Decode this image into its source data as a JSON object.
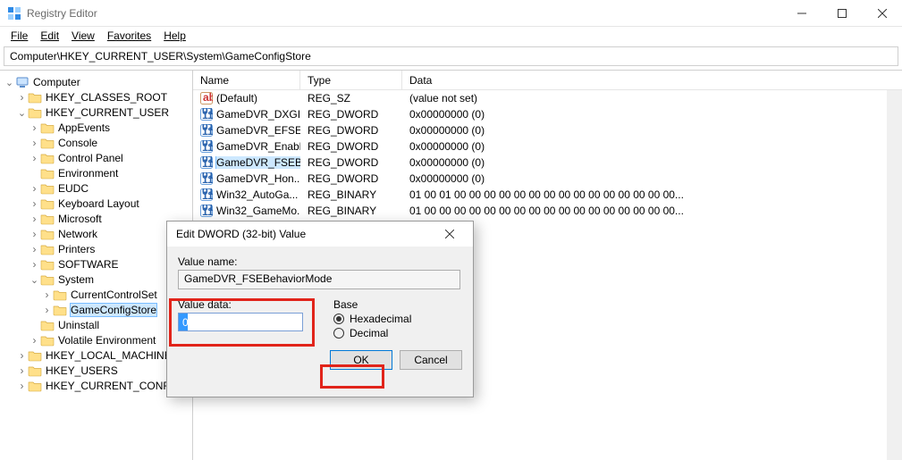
{
  "window": {
    "title": "Registry Editor"
  },
  "menus": {
    "file": "File",
    "edit": "Edit",
    "view": "View",
    "favorites": "Favorites",
    "help": "Help"
  },
  "address": "Computer\\HKEY_CURRENT_USER\\System\\GameConfigStore",
  "tree": {
    "root": "Computer",
    "hkcr": "HKEY_CLASSES_ROOT",
    "hkcu": "HKEY_CURRENT_USER",
    "hkcu_children": {
      "appevents": "AppEvents",
      "console": "Console",
      "controlpanel": "Control Panel",
      "environment": "Environment",
      "eudc": "EUDC",
      "kbd": "Keyboard Layout",
      "microsoft": "Microsoft",
      "network": "Network",
      "printers": "Printers",
      "software": "SOFTWARE",
      "system": "System",
      "ccs": "CurrentControlSet",
      "gamecfg": "GameConfigStore",
      "uninstall": "Uninstall",
      "volatileenv": "Volatile Environment"
    },
    "hklm": "HKEY_LOCAL_MACHINE",
    "hku": "HKEY_USERS",
    "hkcc": "HKEY_CURRENT_CONFIG"
  },
  "cols": {
    "name": "Name",
    "type": "Type",
    "data": "Data"
  },
  "rows": [
    {
      "name": "(Default)",
      "type": "REG_SZ",
      "data": "(value not set)",
      "icon": "str"
    },
    {
      "name": "GameDVR_DXGI...",
      "type": "REG_DWORD",
      "data": "0x00000000 (0)",
      "icon": "num"
    },
    {
      "name": "GameDVR_EFSE...",
      "type": "REG_DWORD",
      "data": "0x00000000 (0)",
      "icon": "num"
    },
    {
      "name": "GameDVR_Enabl...",
      "type": "REG_DWORD",
      "data": "0x00000000 (0)",
      "icon": "num"
    },
    {
      "name": "GameDVR_FSEB...",
      "type": "REG_DWORD",
      "data": "0x00000000 (0)",
      "icon": "num",
      "selected": true
    },
    {
      "name": "GameDVR_Hon...",
      "type": "REG_DWORD",
      "data": "0x00000000 (0)",
      "icon": "num"
    },
    {
      "name": "Win32_AutoGa...",
      "type": "REG_BINARY",
      "data": "01 00 01 00 00 00 00 00 00 00 00 00 00 00 00 00 00 00...",
      "icon": "num"
    },
    {
      "name": "Win32_GameMo...",
      "type": "REG_BINARY",
      "data": "01 00 00 00 00 00 00 00 00 00 00 00 00 00 00 00 00 00...",
      "icon": "num"
    }
  ],
  "dialog": {
    "title": "Edit DWORD (32-bit) Value",
    "valueNameLabel": "Value name:",
    "valueName": "GameDVR_FSEBehaviorMode",
    "valueDataLabel": "Value data:",
    "valueData": "0",
    "baseLabel": "Base",
    "hex": "Hexadecimal",
    "dec": "Decimal",
    "ok": "OK",
    "cancel": "Cancel"
  }
}
